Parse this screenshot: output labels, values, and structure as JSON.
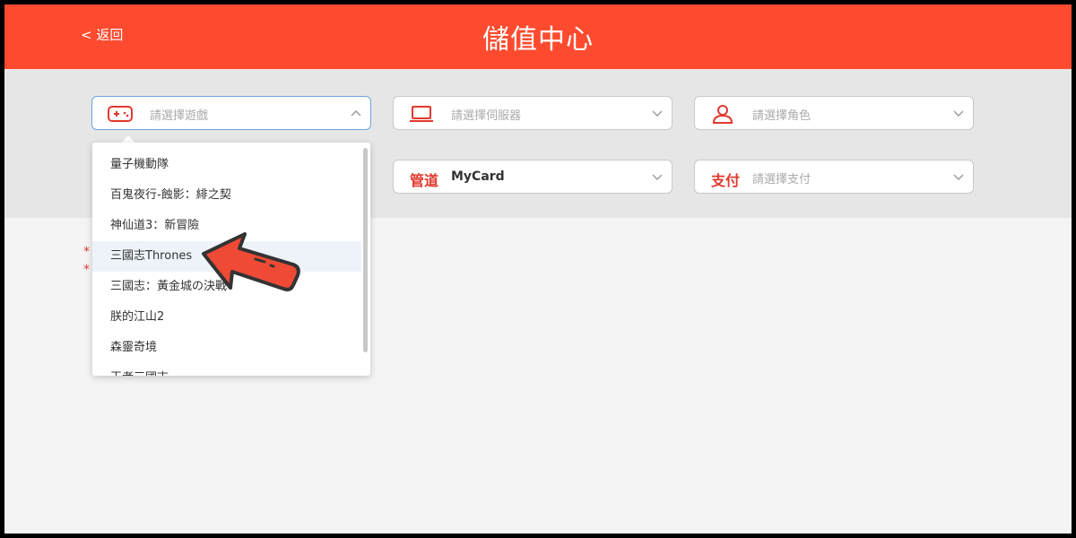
{
  "header": {
    "back_label": "< 返回",
    "title": "儲值中心"
  },
  "selectors": {
    "game": {
      "placeholder": "請選擇遊戲",
      "icon": "gamepad-icon"
    },
    "server": {
      "placeholder": "請選擇伺服器",
      "icon": "laptop-icon"
    },
    "role": {
      "placeholder": "請選擇角色",
      "icon": "user-icon"
    },
    "channel": {
      "label": "管道",
      "value": "MyCard"
    },
    "payment": {
      "label": "支付",
      "placeholder": "請選擇支付"
    }
  },
  "dropdown": {
    "options": [
      "量子機動隊",
      "百鬼夜行-蝕影：緋之契",
      "神仙道3：新冒險",
      "三國志Thrones",
      "三國志：黃金城の決戰",
      "朕的江山2",
      "森靈奇境",
      "王者三國志"
    ],
    "highlighted_index": 3
  },
  "notes": {
    "asterisk1": "*",
    "asterisk2": "*"
  },
  "colors": {
    "brand": "#fe4b2f",
    "accent_red": "#e1392d",
    "focus_border": "#6aa7de"
  }
}
